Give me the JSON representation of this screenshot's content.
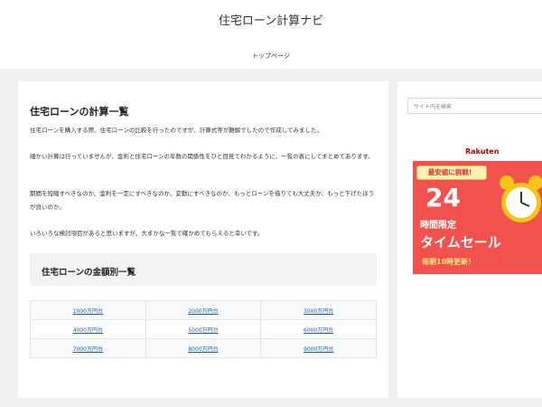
{
  "header": {
    "site_title": "住宅ローン計算ナビ",
    "nav_top": "トップページ"
  },
  "main": {
    "title": "住宅ローンの計算一覧",
    "paragraphs": [
      "住宅ローンを購入する際、住宅ローンの比較を行ったのですが、計算式等が難解でしたので作成してみました。",
      "細かい計算は行っていませんが、金利と住宅ローンの年数の関係性をひと目見てわかるように、一覧の表にしてまとめてあります。",
      "期間を短縮すべきなのか、金利を一定にすべきなのか、変動にすべきなのか、もっとローンを借りても大丈夫か、もっと下げたほうが良いのか。",
      "いろいろな検討項目があると思いますが、大まかな一覧で確かめてもらえると幸いです。"
    ],
    "section_title": "住宅ローンの金額別一覧",
    "amounts": [
      [
        "1000万円台",
        "2000万円台",
        "3000万円台"
      ],
      [
        "4000万円台",
        "5000万円台",
        "6000万円台"
      ],
      [
        "7000万円台",
        "8000万円台",
        "9000万円台"
      ]
    ]
  },
  "sidebar": {
    "search_placeholder": "サイト内を検索",
    "ad": {
      "brand": "Rakuten",
      "badge": "最安値に挑戦！",
      "big": "24",
      "line1": "時間限定",
      "line2": "タイムセール",
      "line3": "毎朝10時更新！",
      "icon": "alarm-clock-icon"
    }
  },
  "colors": {
    "link": "#1a5fb4",
    "ad_red": "#f2514d",
    "background": "#f0f0f0"
  }
}
